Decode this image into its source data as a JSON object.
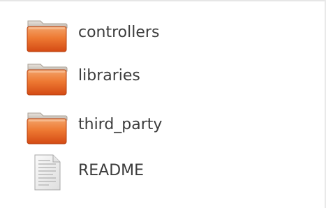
{
  "files": [
    {
      "name": "controllers",
      "type": "folder",
      "icon": "folder-icon"
    },
    {
      "name": "libraries",
      "type": "folder",
      "icon": "folder-icon"
    },
    {
      "name": "third_party",
      "type": "folder",
      "icon": "folder-icon"
    },
    {
      "name": "README",
      "type": "file",
      "icon": "text-file-icon"
    }
  ],
  "colors": {
    "folder_dark": "#d94a12",
    "folder_light": "#f0843f",
    "folder_tab": "#c9c3bb",
    "label_text": "#3c3c3c"
  }
}
